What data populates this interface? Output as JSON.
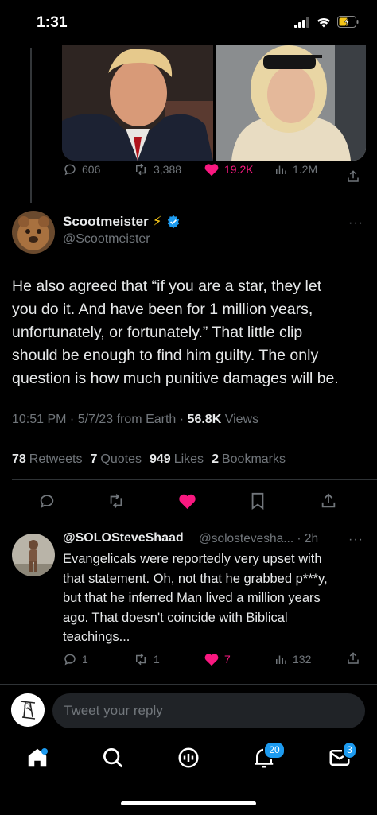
{
  "status_bar": {
    "time": "1:31"
  },
  "media_tweet": {
    "replies": "606",
    "retweets": "3,388",
    "likes": "19.2K",
    "views": "1.2M"
  },
  "main_tweet": {
    "author_name": "Scootmeister",
    "author_emoji": "⚡",
    "author_handle": "@Scootmeister",
    "more": "···",
    "text_lines": [
      "He also agreed that “if you are a star, they let",
      "you do it. And have been for 1 million years,",
      "unfortunately, or fortunately.” That little clip",
      "should be enough to find him guilty. The only",
      "question is how much punitive damages will be."
    ],
    "time": "10:51 PM · 5/7/23 from Earth · ",
    "views_count": "56.8K",
    "views_label": " Views",
    "stats": {
      "retweets_count": "78",
      "retweets_label": "Retweets",
      "quotes_count": "7",
      "quotes_label": "Quotes",
      "likes_count": "949",
      "likes_label": "Likes",
      "bookmarks_count": "2",
      "bookmarks_label": "Bookmarks"
    }
  },
  "reply": {
    "author_name": "@SOLOSteveShaad",
    "author_handle": "@solostevesha... · 2h",
    "more": "···",
    "text_lines": [
      "Evangelicals were reportedly very upset with",
      "that statement. Oh, not that he grabbed p***y,",
      "but that he inferred Man lived a million years",
      "ago. That doesn't coincide with Biblical",
      "teachings..."
    ],
    "replies": "1",
    "retweets": "1",
    "likes": "7",
    "views": "132"
  },
  "compose": {
    "placeholder": "Tweet your reply"
  },
  "nav": {
    "notifications_badge": "20",
    "messages_badge": "3"
  },
  "colors": {
    "like_pink": "#f91880",
    "verified_blue": "#1d9bf0",
    "muted_gray": "#71767b"
  }
}
